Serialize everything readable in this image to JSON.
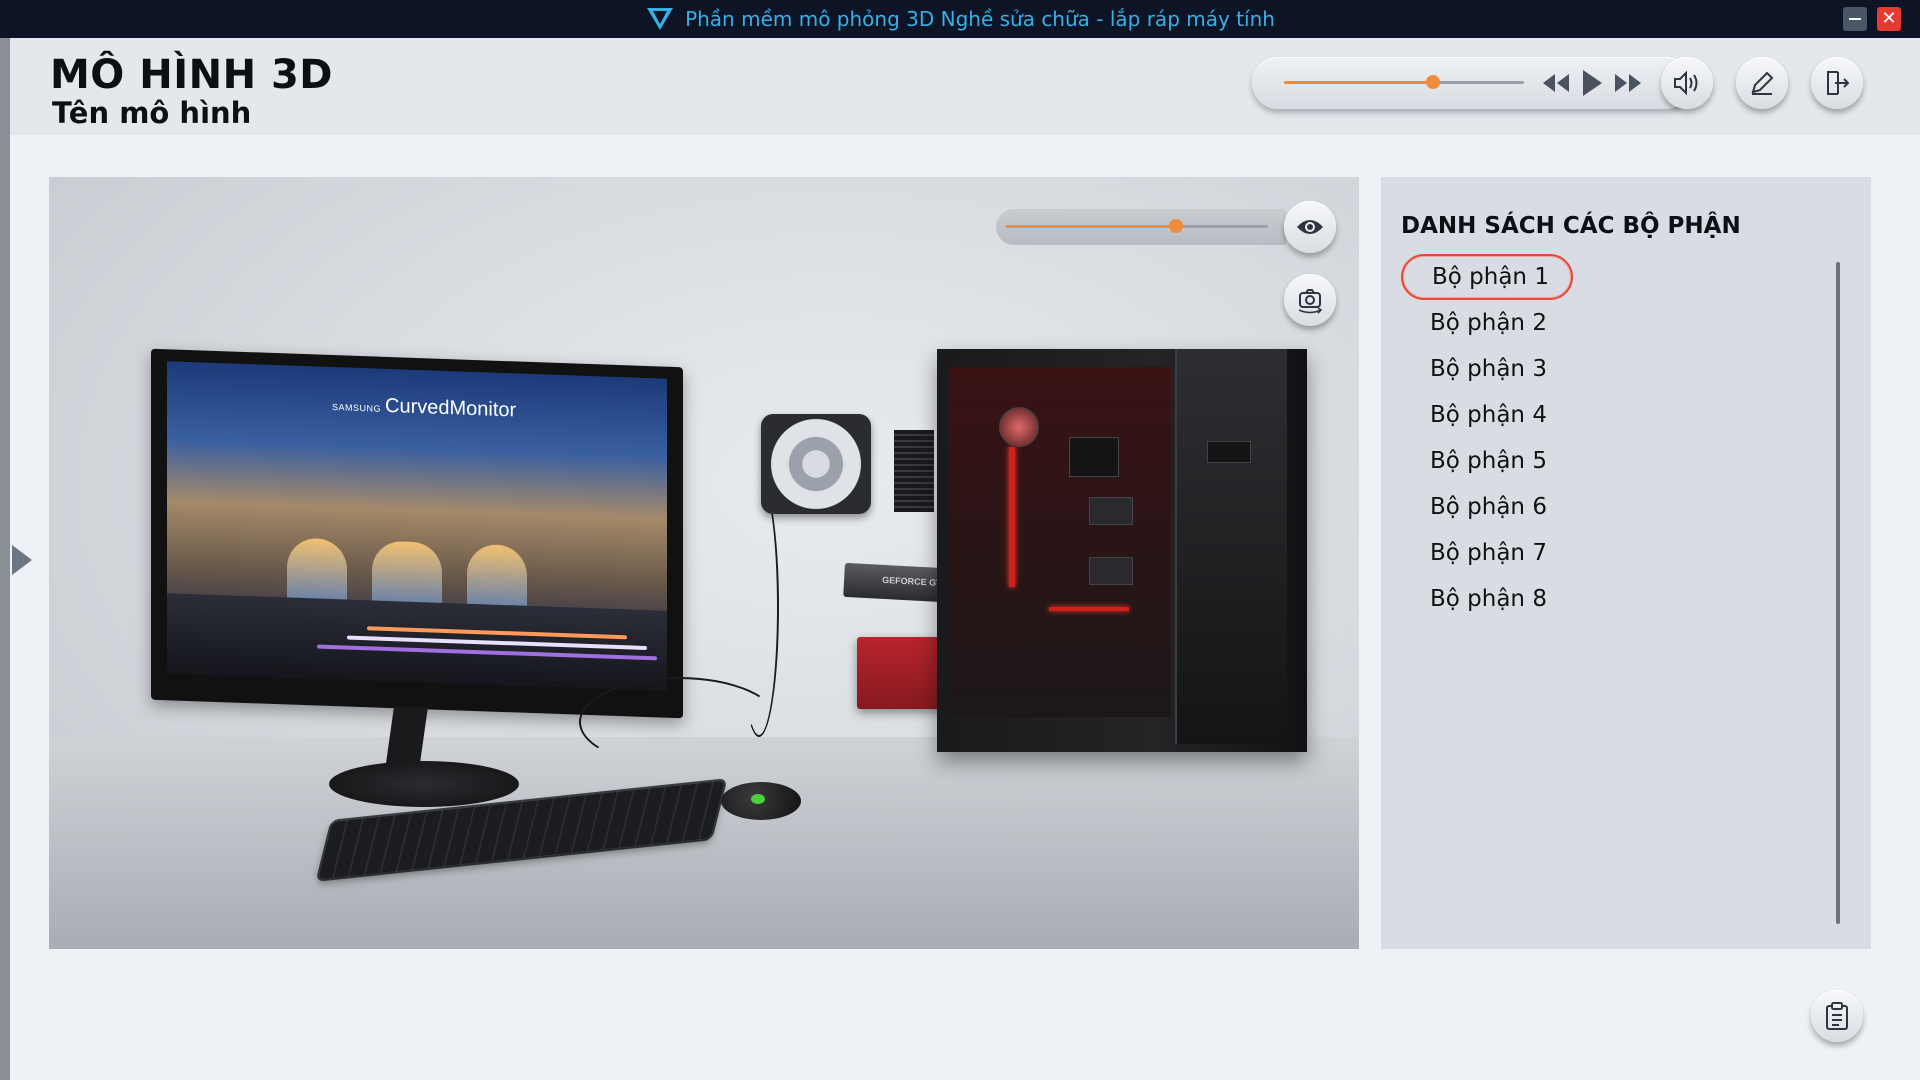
{
  "window": {
    "title": "Phần mềm mô phỏng 3D Nghề sửa chữa - lắp ráp máy tính",
    "minimize_icon": "minimize-icon",
    "close_icon": "close-icon"
  },
  "header": {
    "page_title": "MÔ HÌNH 3D",
    "model_name": "Tên mô hình"
  },
  "media": {
    "progress": 0.62,
    "controls": [
      "rewind-icon",
      "play-icon",
      "fast-forward-icon",
      "volume-icon"
    ],
    "edit_icon": "edit-icon",
    "exit_icon": "exit-icon"
  },
  "viewer": {
    "opacity": 0.65,
    "eye_icon": "eye-icon",
    "camera_icon": "camera-reset-icon",
    "monitor_brand_small": "SAMSUNG",
    "monitor_brand": "CurvedMonitor",
    "gpu_label": "GEFORCE GTX"
  },
  "parts": {
    "title": "DANH SÁCH CÁC BỘ PHẬN",
    "items": [
      "Bộ phận 1",
      "Bộ phận 2",
      "Bộ phận 3",
      "Bộ phận 4",
      "Bộ phận 5",
      "Bộ phận 6",
      "Bộ phận 7",
      "Bộ phận 8"
    ],
    "selected_index": 0
  },
  "footer": {
    "clipboard_icon": "clipboard-icon"
  },
  "colors": {
    "accent": "#f28a3c",
    "titlebar": "#0c1426",
    "title_text": "#37b0e6",
    "selected_border": "#e7483c"
  }
}
